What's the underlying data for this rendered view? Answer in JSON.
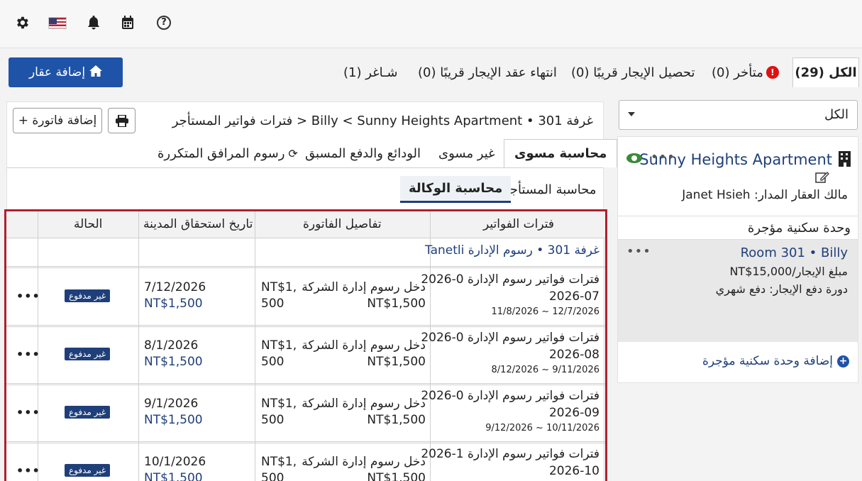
{
  "topbar": {
    "icons": [
      "gear-icon",
      "us-flag-icon",
      "bell-icon",
      "calendar-icon",
      "help-icon"
    ],
    "help_glyph": "?"
  },
  "add_property": {
    "label": "إضافة عقار",
    "icon": "home-icon"
  },
  "filters": {
    "all": "الكل (29)",
    "overdue": "متأخر (0)",
    "rent_due_soon": "تحصيل الإيجار قريبًا (0)",
    "lease_ending_soon": "انتهاء عقد الإيجار قريبًا (0)",
    "vacant": "شـاغر (1)"
  },
  "sidebar": {
    "select_value": "الكل",
    "property_name": "Sunny Heights Apartment",
    "owner": "مالك العقار المدار: Janet Hsieh",
    "units_header": "وحدة سكنية مؤجرة",
    "unit": {
      "title": "Room 301 • Billy",
      "rent": "مبلغ الإيجار/NT$15,000",
      "cycle": "دورة دفع الإيجار: دفع شهري"
    },
    "add_unit": "إضافة وحدة سكنية مؤجرة"
  },
  "main": {
    "add_invoice": "+ إضافة فاتورة",
    "breadcrumb": "غرفة 301 • Billy < Sunny Heights Apartment < فترات فواتير المستأجر",
    "tabs": [
      "محاسبة مسوى",
      "غير مسوى",
      "الودائع والدفع المسبق",
      "رسوم المرافق المتكررة"
    ],
    "subtabs": [
      "محاسبة المستأجر",
      "محاسبة الوكالة"
    ]
  },
  "table": {
    "headers": [
      "فترات الفواتير",
      "تفاصيل الفاتورة",
      "تاريخ استحقاق المدينة",
      "الحالة"
    ],
    "group": "غرفة 301 • رسوم الإدارة Tanetli",
    "rows": [
      {
        "period_a": "فترات فواتير رسوم الإدارة 0-2026",
        "period_b": "2026-07",
        "range": "11/8/2026 ~ 12/7/2026",
        "detail_a": "دخل رسوم إدارة الشركة",
        "detail_b": "NT$1,500",
        "amt_a": "NT$1,",
        "amt_b": "500",
        "due": "7/12/2026",
        "due_amt": "NT$1,500",
        "status": "غير مدفوع"
      },
      {
        "period_a": "فترات فواتير رسوم الإدارة 0-2026",
        "period_b": "2026-08",
        "range": "8/12/2026 ~ 9/11/2026",
        "detail_a": "دخل رسوم إدارة الشركة",
        "detail_b": "NT$1,500",
        "amt_a": "NT$1,",
        "amt_b": "500",
        "due": "8/1/2026",
        "due_amt": "NT$1,500",
        "status": "غير مدفوع"
      },
      {
        "period_a": "فترات فواتير رسوم الإدارة 0-2026",
        "period_b": "2026-09",
        "range": "9/12/2026 ~ 10/11/2026",
        "detail_a": "دخل رسوم إدارة الشركة",
        "detail_b": "NT$1,500",
        "amt_a": "NT$1,",
        "amt_b": "500",
        "due": "9/1/2026",
        "due_amt": "NT$1,500",
        "status": "غير مدفوع"
      },
      {
        "period_a": "فترات فواتير رسوم الإدارة 1-2026",
        "period_b": "2026-10",
        "range": "",
        "detail_a": "دخل رسوم إدارة الشركة",
        "detail_b": "NT$1,500",
        "amt_a": "NT$1,",
        "amt_b": "500",
        "due": "10/1/2026",
        "due_amt": "NT$1,500",
        "status": "غير مدفوع"
      }
    ]
  }
}
